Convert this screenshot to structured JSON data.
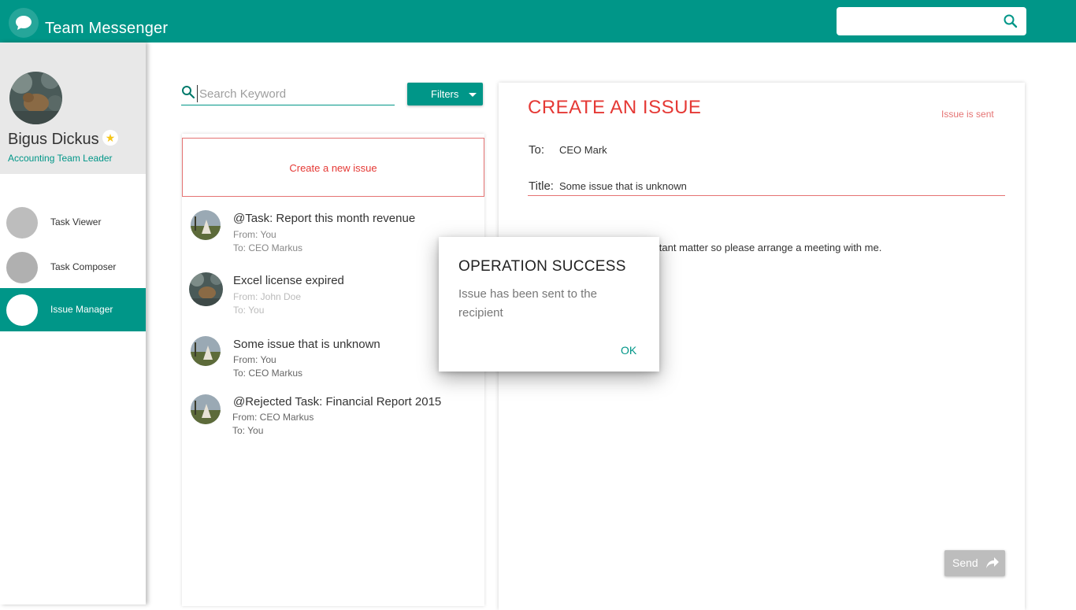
{
  "app": {
    "title": "Team Messenger"
  },
  "top_search": {
    "value": ""
  },
  "profile": {
    "name": "Bigus Dickus",
    "role": "Accounting Team Leader",
    "badge_icon": "star-icon"
  },
  "nav": {
    "items": [
      {
        "label": "Task Viewer",
        "active": false
      },
      {
        "label": "Task Composer",
        "active": false
      },
      {
        "label": "Issue Manager",
        "active": true
      }
    ]
  },
  "list": {
    "search_placeholder": "Search Keyword",
    "filters_label": "Filters",
    "create_new_label": "Create a new issue",
    "issues": [
      {
        "title": "@Task: Report this month revenue",
        "from": "From: You",
        "to": "To: CEO Markus"
      },
      {
        "title": "Excel license expired",
        "from": "From: John Doe",
        "to": "To: You"
      },
      {
        "title": "Some issue that is unknown",
        "from": "From: You",
        "to": "To: CEO Markus"
      },
      {
        "title": "@Rejected Task: Financial Report 2015",
        "from": "From: CEO Markus",
        "to": "To: You"
      }
    ]
  },
  "create_issue": {
    "heading": "CREATE AN ISSUE",
    "status": "Issue is sent",
    "to_label": "To:",
    "to_value": "CEO Mark",
    "title_label": "Title:",
    "title_value": "Some issue that is unknown",
    "body_visible": "portant matter so please arrange a meeting with me.",
    "send_label": "Send"
  },
  "dialog": {
    "title": "OPERATION SUCCESS",
    "message": "Issue has been sent to the recipient",
    "ok_label": "OK"
  },
  "colors": {
    "primary": "#009688",
    "accent_red": "#e53935",
    "sidebar_bg": "#e8e8e8"
  }
}
